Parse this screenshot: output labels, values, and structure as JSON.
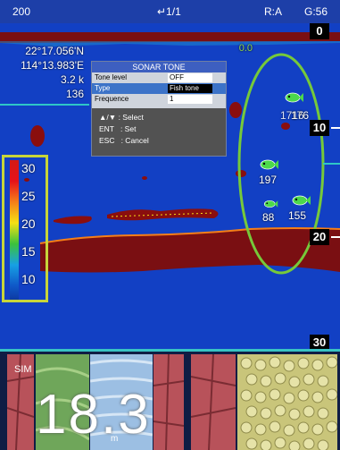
{
  "topbar": {
    "range": "200",
    "page": "↵1/1",
    "mode": "R:A",
    "gain": "G:56"
  },
  "sonar": {
    "aux_value": "0.0",
    "coord_lat": "22°17.056'N",
    "coord_lon": "114°13.983'E",
    "coord_line3": "3.2 k",
    "coord_line4": "136",
    "depth_scale": [
      "0",
      "10",
      "20",
      "30"
    ]
  },
  "popup": {
    "title": "SONAR TONE",
    "rows": [
      {
        "label": "Tone level",
        "value": "OFF"
      },
      {
        "label": "Type",
        "value": "Fish tone"
      },
      {
        "label": "Frequence",
        "value": "1"
      }
    ],
    "help": [
      {
        "key": "▲/▼",
        "desc": ": Select"
      },
      {
        "key": "ENT",
        "desc": ": Set"
      },
      {
        "key": "ESC",
        "desc": ": Cancel"
      }
    ]
  },
  "fish_markers": [
    {
      "label": "176"
    },
    {
      "label": "1716"
    },
    {
      "label": "197"
    },
    {
      "label": "88"
    },
    {
      "label": "155"
    }
  ],
  "color_scale": {
    "labels": [
      "30",
      "25",
      "20",
      "15",
      "10"
    ]
  },
  "bottom": {
    "sim_label": "SIM",
    "depth_value": "18.3",
    "depth_unit": "m"
  },
  "colors": {
    "sonar_background": "#1240c4",
    "echo_red": "#8a0e0e",
    "fish_green": "#4cd84c",
    "highlight_green": "#76c93a",
    "scale_box": "#c7d53a",
    "accent_cyan": "#39c3c3"
  }
}
